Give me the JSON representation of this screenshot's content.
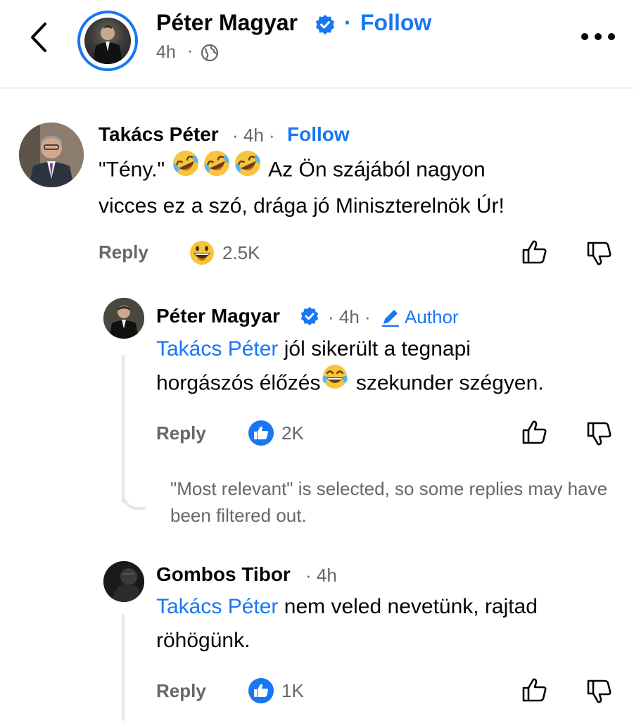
{
  "post_header": {
    "name": "Péter Magyar",
    "dot": "·",
    "follow": "Follow",
    "time": "4h",
    "time_dot": "·"
  },
  "comments": [
    {
      "name": "Takács Péter",
      "meta": "· 4h ·",
      "follow": "Follow",
      "text_part1": "\"Tény.\"",
      "text_part2": "Az Ön szájából nagyon",
      "text_line2": "vicces ez a szó, drága jó Miniszterelnök Úr!",
      "reply": "Reply",
      "reaction_count": "2.5K"
    }
  ],
  "replies": [
    {
      "name": "Péter Magyar",
      "meta": "· 4h ·",
      "author_label": "Author",
      "mention": "Takács Péter",
      "text_line1": "jól sikerült a tegnapi",
      "text_line2a": "horgászós élőzés",
      "text_line2b": "szekunder szégyen.",
      "reply": "Reply",
      "reaction_count": "2K"
    },
    {
      "name": "Gombos Tibor",
      "meta": "· 4h",
      "mention": "Takács Péter",
      "text_line1": "nem veled nevetünk, rajtad",
      "text_line2": "röhögünk.",
      "reply": "Reply",
      "reaction_count": "1K"
    }
  ],
  "filter_note": "\"Most relevant\" is selected, so some replies may have been filtered out.",
  "colors": {
    "accent": "#1877f2",
    "secondary_text": "#65676b",
    "primary_text": "#050505"
  },
  "icons": [
    "back-arrow-icon",
    "verified-badge-icon",
    "globe-icon",
    "more-icon",
    "rolling-laughing-emoji",
    "grinning-emoji",
    "tears-of-joy-emoji",
    "like-reaction-icon",
    "thumbs-up-icon",
    "thumbs-down-icon",
    "pencil-icon"
  ]
}
